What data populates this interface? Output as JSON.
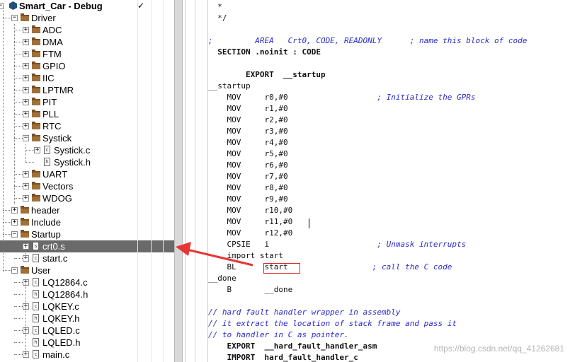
{
  "project": {
    "title": "Smart_Car - Debug",
    "check_mark": "✓"
  },
  "tree": [
    {
      "label": "Driver",
      "type": "folder",
      "level": 1,
      "toggle": "−"
    },
    {
      "label": "ADC",
      "type": "folder",
      "level": 2,
      "toggle": "+"
    },
    {
      "label": "DMA",
      "type": "folder",
      "level": 2,
      "toggle": "+"
    },
    {
      "label": "FTM",
      "type": "folder",
      "level": 2,
      "toggle": "+"
    },
    {
      "label": "GPIO",
      "type": "folder",
      "level": 2,
      "toggle": "+"
    },
    {
      "label": "IIC",
      "type": "folder",
      "level": 2,
      "toggle": "+"
    },
    {
      "label": "LPTMR",
      "type": "folder",
      "level": 2,
      "toggle": "+"
    },
    {
      "label": "PIT",
      "type": "folder",
      "level": 2,
      "toggle": "+"
    },
    {
      "label": "PLL",
      "type": "folder",
      "level": 2,
      "toggle": "+"
    },
    {
      "label": "RTC",
      "type": "folder",
      "level": 2,
      "toggle": "+"
    },
    {
      "label": "Systick",
      "type": "folder",
      "level": 2,
      "toggle": "−"
    },
    {
      "label": "Systick.c",
      "type": "file",
      "level": 3,
      "toggle": "+",
      "icon": "c"
    },
    {
      "label": "Systick.h",
      "type": "file",
      "level": 3,
      "toggle": "",
      "icon": "h"
    },
    {
      "label": "UART",
      "type": "folder",
      "level": 2,
      "toggle": "+"
    },
    {
      "label": "Vectors",
      "type": "folder",
      "level": 2,
      "toggle": "+"
    },
    {
      "label": "WDOG",
      "type": "folder",
      "level": 2,
      "toggle": "+"
    },
    {
      "label": "header",
      "type": "folder",
      "level": 1,
      "toggle": "+"
    },
    {
      "label": "Include",
      "type": "folder",
      "level": 1,
      "toggle": "+"
    },
    {
      "label": "Startup",
      "type": "folder",
      "level": 1,
      "toggle": "−"
    },
    {
      "label": "crt0.s",
      "type": "file",
      "level": 2,
      "toggle": "+",
      "icon": "s",
      "selected": true
    },
    {
      "label": "start.c",
      "type": "file",
      "level": 2,
      "toggle": "+",
      "icon": "c"
    },
    {
      "label": "User",
      "type": "folder",
      "level": 1,
      "toggle": "−"
    },
    {
      "label": "LQ12864.c",
      "type": "file",
      "level": 2,
      "toggle": "+",
      "icon": "c"
    },
    {
      "label": "LQ12864.h",
      "type": "file",
      "level": 2,
      "toggle": "",
      "icon": "h"
    },
    {
      "label": "LQKEY.c",
      "type": "file",
      "level": 2,
      "toggle": "+",
      "icon": "c"
    },
    {
      "label": "LQKEY.h",
      "type": "file",
      "level": 2,
      "toggle": "",
      "icon": "h"
    },
    {
      "label": "LQLED.c",
      "type": "file",
      "level": 2,
      "toggle": "+",
      "icon": "c"
    },
    {
      "label": "LQLED.h",
      "type": "file",
      "level": 2,
      "toggle": "",
      "icon": "h"
    },
    {
      "label": "main.c",
      "type": "file",
      "level": 2,
      "toggle": "+",
      "icon": "c"
    }
  ],
  "code_lines": [
    {
      "code": "  *",
      "comment": "",
      "dir": false
    },
    {
      "code": "  */",
      "comment": "",
      "dir": false
    },
    {
      "code": "",
      "comment": "",
      "dir": false
    },
    {
      "code": "",
      "comment": ";         AREA   Crt0, CODE, READONLY      ; name this block of code",
      "dir": false
    },
    {
      "code": "  SECTION .noinit : CODE",
      "comment": "",
      "dir": true
    },
    {
      "code": "",
      "comment": "",
      "dir": false
    },
    {
      "code": "        EXPORT  __startup",
      "comment": "",
      "dir": true
    },
    {
      "code": "__startup",
      "comment": "",
      "dir": false
    },
    {
      "code": "    MOV     r0,#0                   ",
      "comment": "; Initialize the GPRs",
      "dir": false
    },
    {
      "code": "    MOV     r1,#0",
      "comment": "",
      "dir": false
    },
    {
      "code": "    MOV     r2,#0",
      "comment": "",
      "dir": false
    },
    {
      "code": "    MOV     r3,#0",
      "comment": "",
      "dir": false
    },
    {
      "code": "    MOV     r4,#0",
      "comment": "",
      "dir": false
    },
    {
      "code": "    MOV     r5,#0",
      "comment": "",
      "dir": false
    },
    {
      "code": "    MOV     r6,#0",
      "comment": "",
      "dir": false
    },
    {
      "code": "    MOV     r7,#0",
      "comment": "",
      "dir": false
    },
    {
      "code": "    MOV     r8,#0",
      "comment": "",
      "dir": false
    },
    {
      "code": "    MOV     r9,#0",
      "comment": "",
      "dir": false
    },
    {
      "code": "    MOV     r10,#0",
      "comment": "",
      "dir": false
    },
    {
      "code": "    MOV     r11,#0",
      "comment": "",
      "dir": false
    },
    {
      "code": "    MOV     r12,#0",
      "comment": "",
      "dir": false
    },
    {
      "code": "    CPSIE   i                       ",
      "comment": "; Unmask interrupts",
      "dir": false
    },
    {
      "code": "    import start",
      "comment": "",
      "dir": false
    },
    {
      "code": "    BL      start                  ",
      "comment": "; call the C code",
      "dir": false
    },
    {
      "code": "__done",
      "comment": "",
      "dir": false
    },
    {
      "code": "    B       __done",
      "comment": "",
      "dir": false
    },
    {
      "code": "",
      "comment": "",
      "dir": false
    },
    {
      "code": "",
      "comment": "// hard fault handler wrapper in assembly",
      "dir": false
    },
    {
      "code": "",
      "comment": "// it extract the location of stack frame and pass it",
      "dir": false
    },
    {
      "code": "",
      "comment": "// to handler in C as pointer.",
      "dir": false
    },
    {
      "code": "    EXPORT  __hard_fault_handler_asm",
      "comment": "",
      "dir": true
    },
    {
      "code": "    IMPORT  hard_fault_handler_c",
      "comment": "",
      "dir": true
    }
  ],
  "watermark": "https://blog.csdn.net/qq_41262681",
  "colors": {
    "comment": "#2a2acc",
    "selection": "#6a6a6a",
    "annotation": "#e02020"
  }
}
